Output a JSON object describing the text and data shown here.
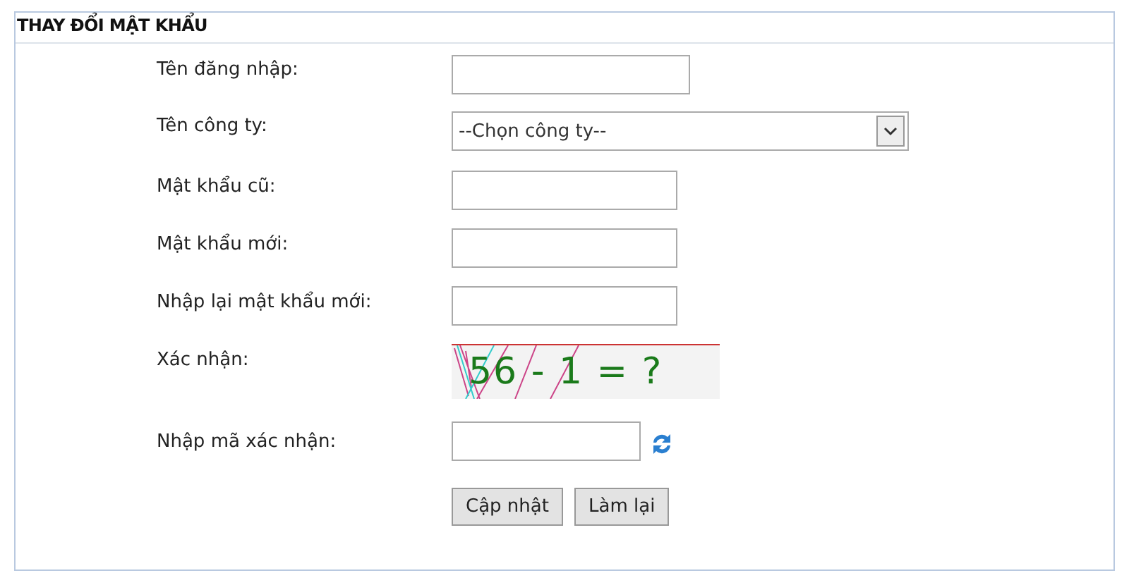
{
  "panel": {
    "title": "THAY ĐỔI MẬT KHẨU"
  },
  "fields": [
    {
      "kind": "text",
      "label": "Tên đăng nhập:"
    },
    {
      "kind": "select",
      "label": "Tên công ty:",
      "value": "--Chọn công ty--"
    },
    {
      "kind": "password",
      "label": "Mật khẩu cũ:"
    },
    {
      "kind": "password",
      "label": "Mật khẩu mới:"
    },
    {
      "kind": "password",
      "label": "Nhập lại mật khẩu mới:"
    },
    {
      "kind": "captcha",
      "label": "Xác nhận:",
      "value": "56 - 1 = ?"
    },
    {
      "kind": "captcha_input",
      "label": "Nhập mã xác nhận:"
    }
  ],
  "buttons": [
    "Cập nhật",
    "Làm lại"
  ]
}
